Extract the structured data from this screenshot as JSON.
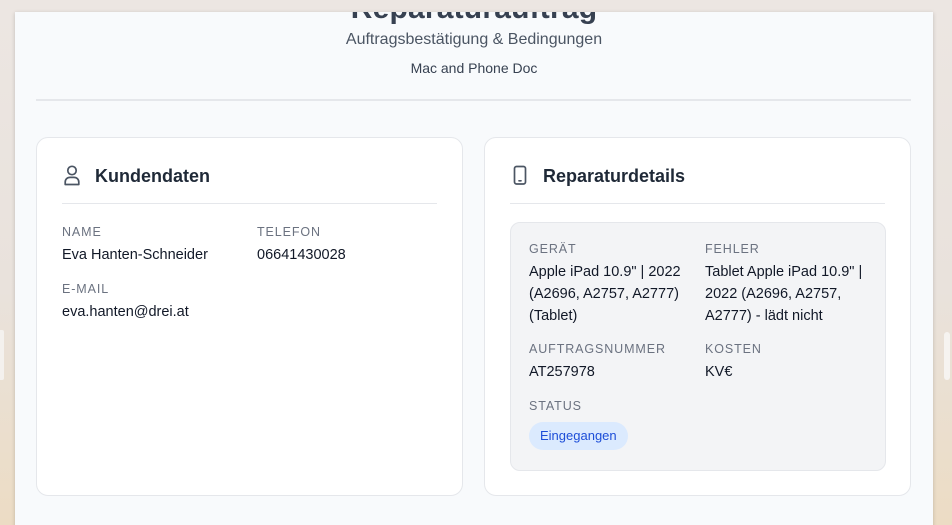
{
  "document": {
    "title": "Reparaturauftrag",
    "subtitle": "Auftragsbestätigung & Bedingungen",
    "company": "Mac and Phone Doc"
  },
  "customer": {
    "heading": "Kundendaten",
    "icon": "person-icon",
    "name_label": "NAME",
    "name": "Eva Hanten-Schneider",
    "phone_label": "TELEFON",
    "phone": "06641430028",
    "email_label": "E-MAIL",
    "email": "eva.hanten@drei.at"
  },
  "repair": {
    "heading": "Reparaturdetails",
    "icon": "phone-icon",
    "device_label": "GERÄT",
    "device": "Apple iPad 10.9\" | 2022 (A2696, A2757, A2777) (Tablet)",
    "fault_label": "FEHLER",
    "fault": "Tablet Apple iPad 10.9\" | 2022 (A2696, A2757, A2777) - lädt nicht",
    "order_label": "AUFTRAGSNUMMER",
    "order_number": "AT257978",
    "cost_label": "KOSTEN",
    "cost": "KV€",
    "status_label": "STATUS",
    "status": "Eingegangen"
  },
  "colors": {
    "badge_bg": "#dbeafe",
    "badge_text": "#1d4ed8",
    "card_border": "#e5e7eb"
  }
}
